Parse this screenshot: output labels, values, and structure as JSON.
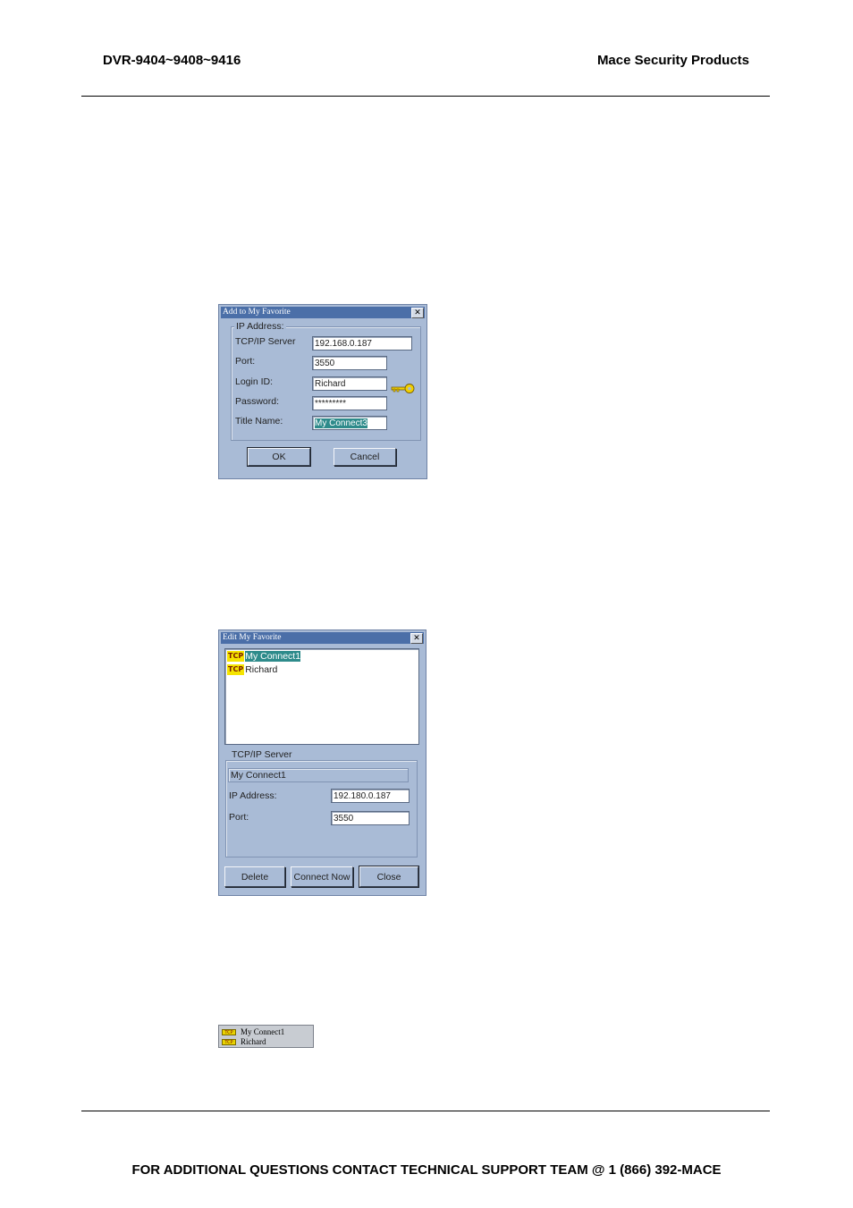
{
  "header": {
    "left": "DVR-9404~9408~9416",
    "right": "Mace Security Products"
  },
  "footer": {
    "text": "FOR ADDITIONAL QUESTIONS CONTACT TECHNICAL SUPPORT TEAM @ 1 (866) 392-MACE"
  },
  "add_dialog": {
    "title": "Add to My Favorite",
    "close_glyph": "✕",
    "group_title": "IP Address:",
    "fields": {
      "tcp_label": "TCP/IP Server",
      "tcp_value": "192.168.0.187",
      "port_label": "Port:",
      "port_value": "3550",
      "login_label": "Login ID:",
      "login_value": "Richard",
      "password_label": "Password:",
      "password_value": "*********",
      "title_label": "Title Name:",
      "title_value": "My Connect3"
    },
    "ok_label": "OK",
    "cancel_label": "Cancel"
  },
  "edit_dialog": {
    "title": "Edit My Favorite",
    "close_glyph": "✕",
    "tcp_tag": "TCP",
    "items": [
      "My Connect1",
      "Richard"
    ],
    "group_title": "TCP/IP Server",
    "selected_name": "My Connect1",
    "ip_label": "IP Address:",
    "ip_value": "192.180.0.187",
    "port_label": "Port:",
    "port_value": "3550",
    "delete_label": "Delete",
    "connect_label": "Connect Now",
    "close_label": "Close"
  },
  "mini_list": {
    "tcp_tag": "TCP",
    "items": [
      "My Connect1",
      "Richard"
    ]
  },
  "colors": {
    "dialog_bg": "#a9bbd6",
    "titlebar": "#4b6fa8",
    "selection": "#2e8b8b",
    "tcp_badge": "#f5e400"
  }
}
